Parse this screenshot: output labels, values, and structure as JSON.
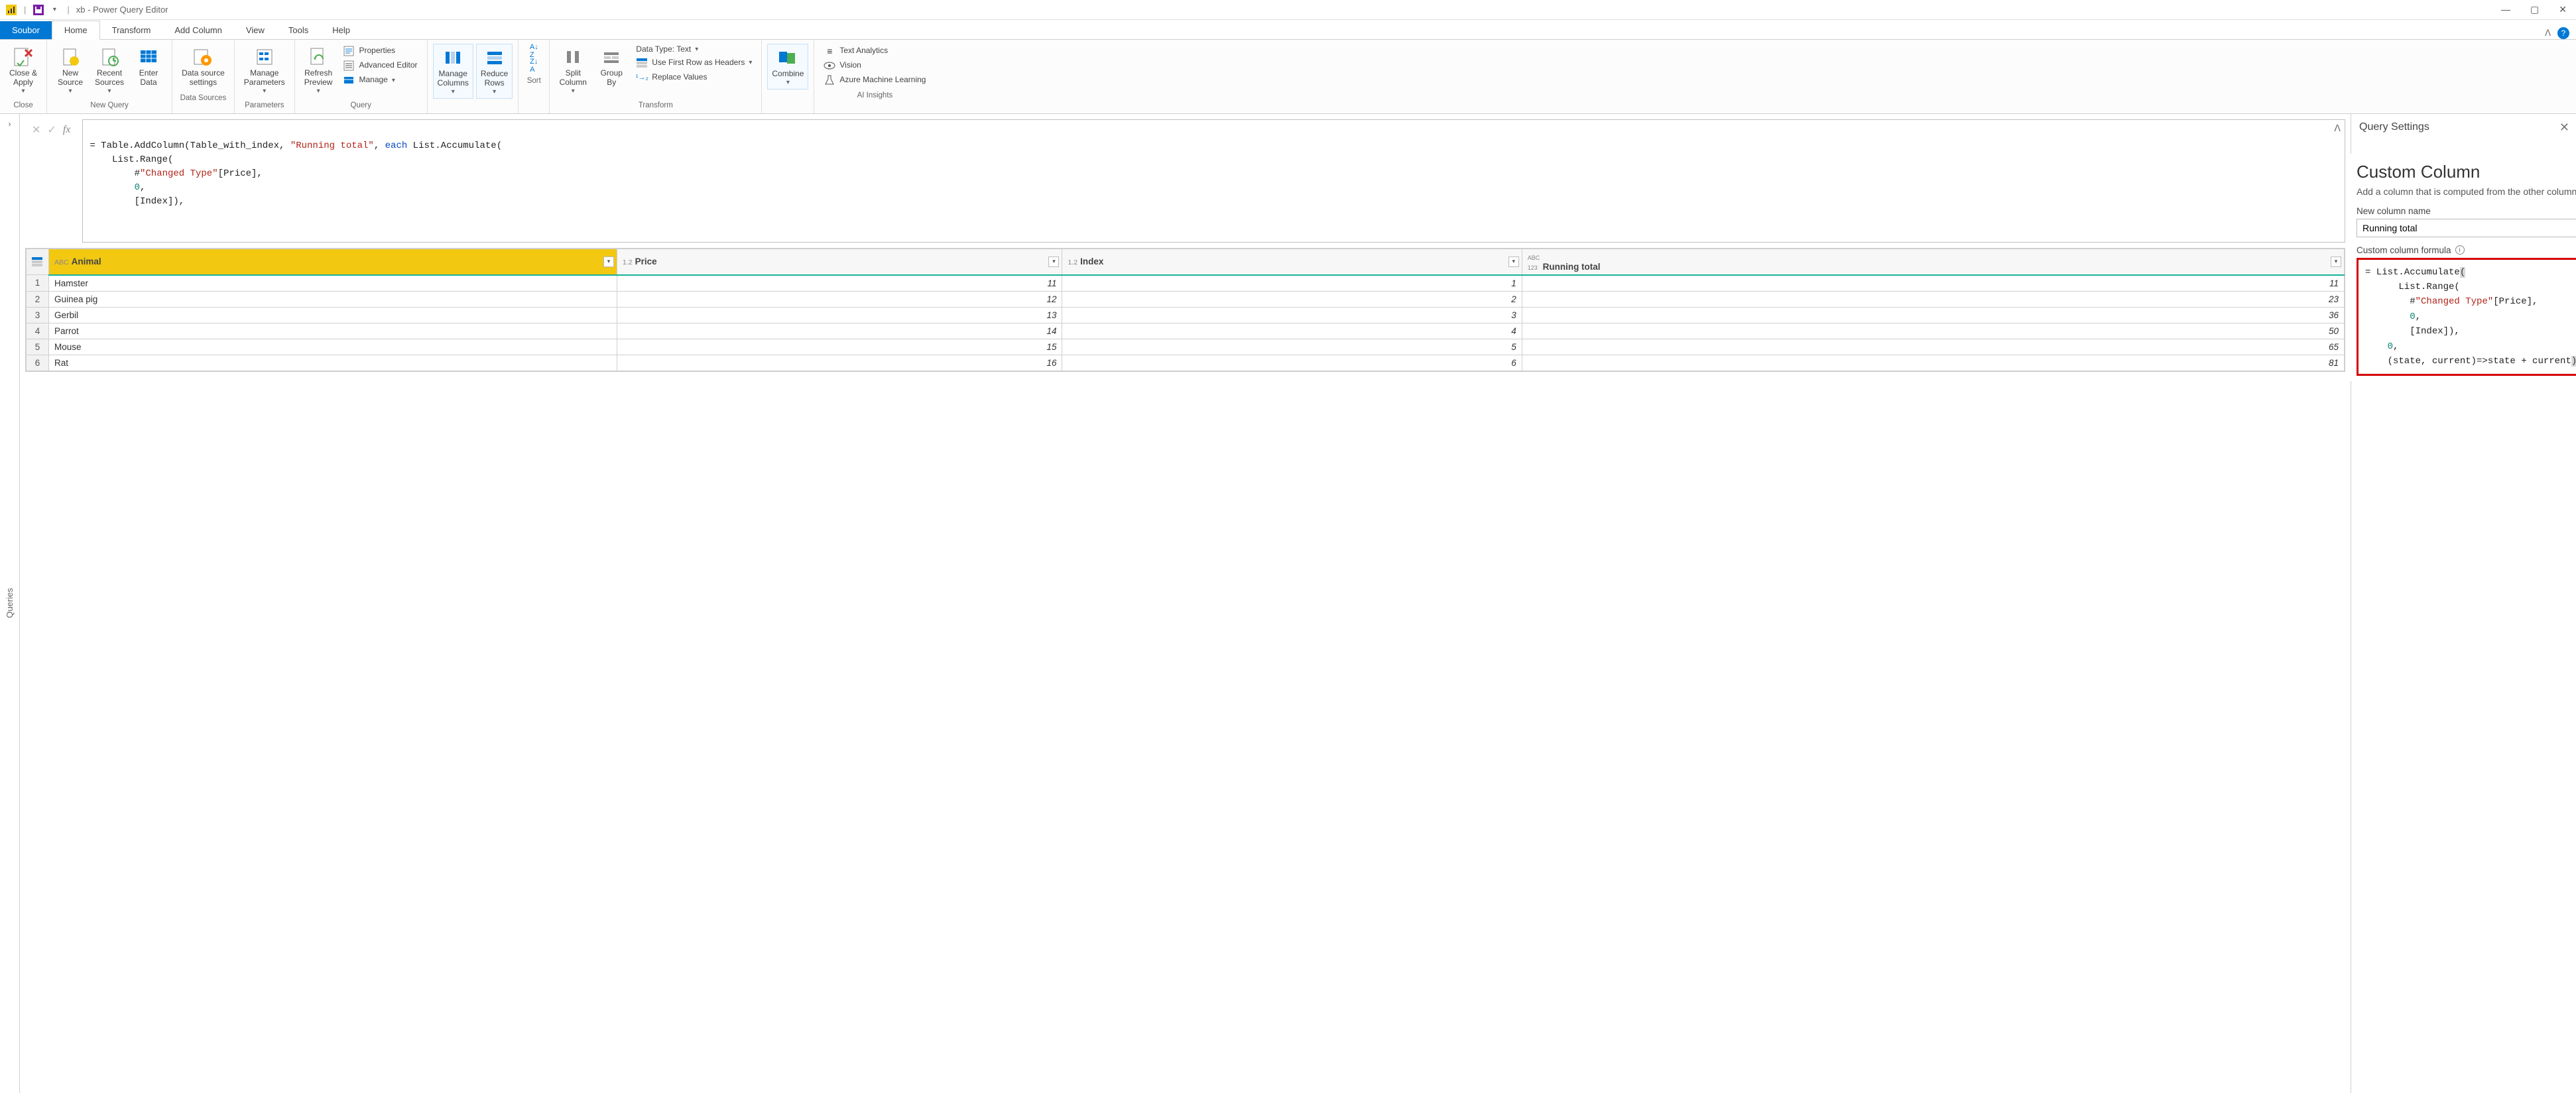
{
  "window": {
    "title": "xb - Power Query Editor"
  },
  "tabs": {
    "file": "Soubor",
    "home": "Home",
    "transform": "Transform",
    "addcol": "Add Column",
    "view": "View",
    "tools": "Tools",
    "help": "Help"
  },
  "ribbon": {
    "close": {
      "closeApply": "Close &\nApply",
      "group": "Close"
    },
    "newquery": {
      "newSource": "New\nSource",
      "recentSources": "Recent\nSources",
      "enterData": "Enter\nData",
      "group": "New Query"
    },
    "datasources": {
      "settings": "Data source\nsettings",
      "group": "Data Sources"
    },
    "parameters": {
      "manage": "Manage\nParameters",
      "group": "Parameters"
    },
    "query": {
      "refresh": "Refresh\nPreview",
      "properties": "Properties",
      "advEditor": "Advanced Editor",
      "manage": "Manage",
      "group": "Query"
    },
    "cols": {
      "manageCols": "Manage\nColumns",
      "reduceRows": "Reduce\nRows"
    },
    "sort": {
      "group": "Sort"
    },
    "transform": {
      "split": "Split\nColumn",
      "groupby": "Group\nBy",
      "datatype": "Data Type: Text",
      "firstrow": "Use First Row as Headers",
      "replace": "Replace Values",
      "group": "Transform"
    },
    "combine": {
      "combine": "Combine"
    },
    "ai": {
      "text": "Text Analytics",
      "vision": "Vision",
      "aml": "Azure Machine Learning",
      "group": "AI Insights"
    }
  },
  "queriesTab": "Queries",
  "formula": {
    "l1_pre": "= Table.AddColumn(Table_with_index, ",
    "l1_str": "\"Running total\"",
    "l1_mid": ", ",
    "l1_kw": "each",
    "l1_post": " List.Accumulate(",
    "l2": "    List.Range(",
    "l3a": "        #",
    "l3b": "\"Changed Type\"",
    "l3c": "[Price],",
    "l4": "        0",
    "l4b": ",",
    "l5": "        [Index]),"
  },
  "grid": {
    "rowcol": "",
    "cols": [
      {
        "type": "ABC",
        "name": "Animal",
        "selected": true
      },
      {
        "type": "1.2",
        "name": "Price"
      },
      {
        "type": "1.2",
        "name": "Index"
      },
      {
        "type": "ABC123",
        "name": "Running total"
      }
    ],
    "rows": [
      {
        "n": 1,
        "Animal": "Hamster",
        "Price": "11",
        "Index": "1",
        "Running": "11"
      },
      {
        "n": 2,
        "Animal": "Guinea pig",
        "Price": "12",
        "Index": "2",
        "Running": "23"
      },
      {
        "n": 3,
        "Animal": "Gerbil",
        "Price": "13",
        "Index": "3",
        "Running": "36"
      },
      {
        "n": 4,
        "Animal": "Parrot",
        "Price": "14",
        "Index": "4",
        "Running": "50"
      },
      {
        "n": 5,
        "Animal": "Mouse",
        "Price": "15",
        "Index": "5",
        "Running": "65"
      },
      {
        "n": 6,
        "Animal": "Rat",
        "Price": "16",
        "Index": "6",
        "Running": "81"
      }
    ]
  },
  "querySettings": {
    "title": "Query Settings"
  },
  "popup": {
    "title": "Custom Column",
    "desc": "Add a column that is computed from the other columns.",
    "nameLabel": "New column name",
    "nameValue": "Running total",
    "formulaLabel": "Custom column formula",
    "f1": "= List.Accumulate",
    "f1b": "(",
    "f2": "      List.Range(",
    "f3a": "        #",
    "f3b": "\"Changed Type\"",
    "f3c": "[Price],",
    "f4a": "        0",
    "f4b": ",",
    "f5": "        [Index]),",
    "f6a": "    0",
    "f6b": ",",
    "f7": "    (state, current)=>state + current",
    "f7b": ")"
  },
  "chart_data": {
    "type": "table",
    "columns": [
      "Animal",
      "Price",
      "Index",
      "Running total"
    ],
    "rows": [
      [
        "Hamster",
        11,
        1,
        11
      ],
      [
        "Guinea pig",
        12,
        2,
        23
      ],
      [
        "Gerbil",
        13,
        3,
        36
      ],
      [
        "Parrot",
        14,
        4,
        50
      ],
      [
        "Mouse",
        15,
        5,
        65
      ],
      [
        "Rat",
        16,
        6,
        81
      ]
    ]
  }
}
